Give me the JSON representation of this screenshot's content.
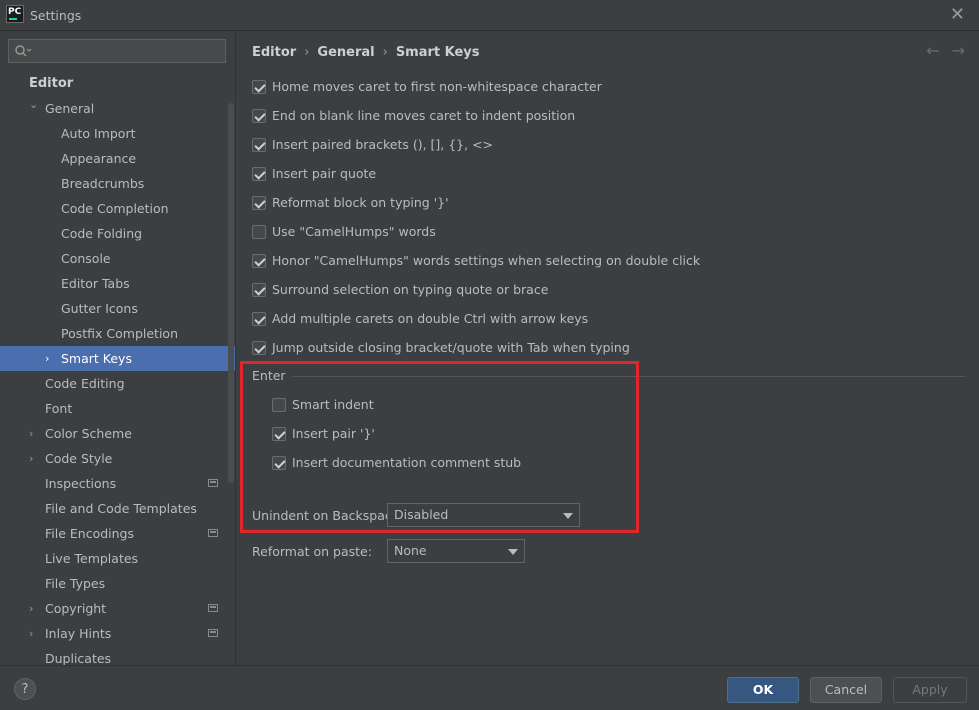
{
  "window": {
    "title": "Settings",
    "app_icon_text": "PC"
  },
  "sidebar": {
    "search_placeholder": "",
    "category": "Editor",
    "items": [
      {
        "label": "General",
        "indent": 1,
        "chevron": "expanded"
      },
      {
        "label": "Auto Import",
        "indent": 2
      },
      {
        "label": "Appearance",
        "indent": 2
      },
      {
        "label": "Breadcrumbs",
        "indent": 2
      },
      {
        "label": "Code Completion",
        "indent": 2
      },
      {
        "label": "Code Folding",
        "indent": 2
      },
      {
        "label": "Console",
        "indent": 2
      },
      {
        "label": "Editor Tabs",
        "indent": 2
      },
      {
        "label": "Gutter Icons",
        "indent": 2
      },
      {
        "label": "Postfix Completion",
        "indent": 2
      },
      {
        "label": "Smart Keys",
        "indent": 2,
        "chevron": "collapsed",
        "selected": true
      },
      {
        "label": "Code Editing",
        "indent": 1
      },
      {
        "label": "Font",
        "indent": 1
      },
      {
        "label": "Color Scheme",
        "indent": 1,
        "chevron": "collapsed"
      },
      {
        "label": "Code Style",
        "indent": 1,
        "chevron": "collapsed"
      },
      {
        "label": "Inspections",
        "indent": 1,
        "project_icon": true
      },
      {
        "label": "File and Code Templates",
        "indent": 1
      },
      {
        "label": "File Encodings",
        "indent": 1,
        "project_icon": true
      },
      {
        "label": "Live Templates",
        "indent": 1
      },
      {
        "label": "File Types",
        "indent": 1
      },
      {
        "label": "Copyright",
        "indent": 1,
        "chevron": "collapsed",
        "project_icon": true
      },
      {
        "label": "Inlay Hints",
        "indent": 1,
        "chevron": "collapsed",
        "project_icon": true
      },
      {
        "label": "Duplicates",
        "indent": 1
      }
    ]
  },
  "breadcrumb": [
    "Editor",
    "General",
    "Smart Keys"
  ],
  "options": [
    {
      "label": "Home moves caret to first non-whitespace character",
      "checked": true
    },
    {
      "label": "End on blank line moves caret to indent position",
      "checked": true
    },
    {
      "label": "Insert paired brackets (), [], {}, <>",
      "checked": true
    },
    {
      "label": "Insert pair quote",
      "checked": true
    },
    {
      "label": "Reformat block on typing '}'",
      "checked": true
    },
    {
      "label": "Use \"CamelHumps\" words",
      "checked": false
    },
    {
      "label": "Honor \"CamelHumps\" words settings when selecting on double click",
      "checked": true
    },
    {
      "label": "Surround selection on typing quote or brace",
      "checked": true
    },
    {
      "label": "Add multiple carets on double Ctrl with arrow keys",
      "checked": true
    },
    {
      "label": "Jump outside closing bracket/quote with Tab when typing",
      "checked": true
    }
  ],
  "enter_group": {
    "title": "Enter",
    "options": [
      {
        "label": "Smart indent",
        "checked": false
      },
      {
        "label": "Insert pair '}'",
        "checked": true
      },
      {
        "label": "Insert documentation comment stub",
        "checked": true
      }
    ]
  },
  "unindent": {
    "label": "Unindent on Backspace:",
    "value": "Disabled"
  },
  "reformat": {
    "label": "Reformat on paste:",
    "value": "None"
  },
  "footer": {
    "help": "?",
    "ok": "OK",
    "cancel": "Cancel",
    "apply": "Apply"
  },
  "colors": {
    "background": "#3c3f41",
    "selection": "#4b6eaf",
    "highlight_box": "#e0262b",
    "ok_button": "#365880"
  }
}
